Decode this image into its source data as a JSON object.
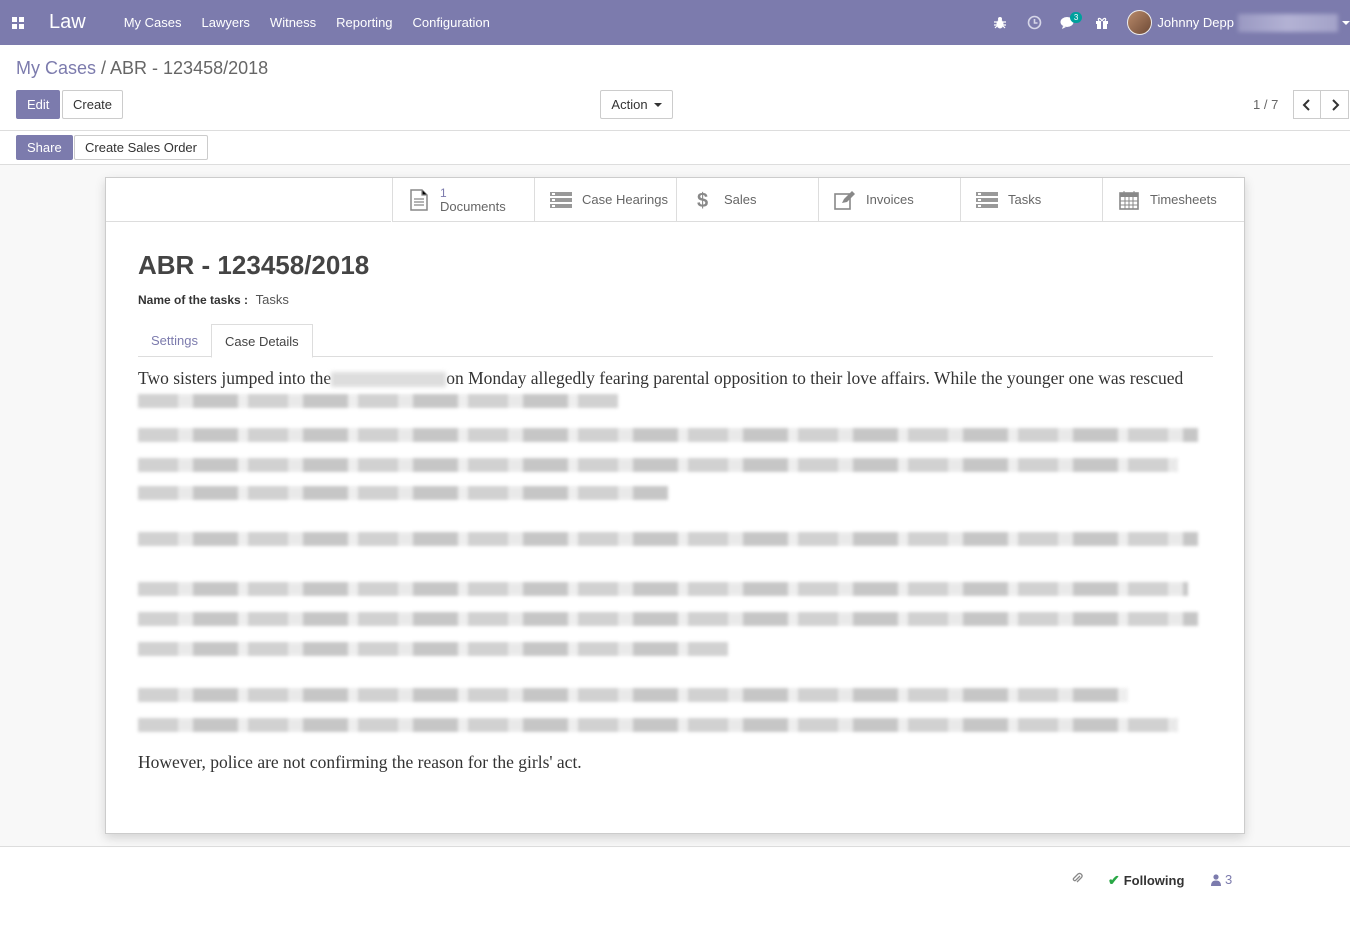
{
  "navbar": {
    "brand": "Law",
    "menu": [
      "My Cases",
      "Lawyers",
      "Witness",
      "Reporting",
      "Configuration"
    ],
    "chat_count": "3",
    "user_name": "Johnny Depp"
  },
  "control": {
    "breadcrumb_parent": "My Cases",
    "breadcrumb_sep": " / ",
    "breadcrumb_current": "ABR - 123458/2018",
    "edit_label": "Edit",
    "create_label": "Create",
    "action_label": "Action",
    "pager": "1 / 7"
  },
  "statusbar": {
    "share_label": "Share",
    "sales_order_label": "Create Sales Order"
  },
  "buttons": {
    "documents_count": "1",
    "documents_label": "Documents",
    "hearings_label": "Case Hearings",
    "sales_label": "Sales",
    "invoices_label": "Invoices",
    "tasks_label": "Tasks",
    "timesheets_label": "Timesheets"
  },
  "form": {
    "title": "ABR - 123458/2018",
    "field_label": "Name of the tasks :",
    "field_value": "Tasks",
    "tabs": [
      "Settings",
      "Case Details"
    ],
    "active_tab": "Case Details"
  },
  "details": {
    "first_start": "Two sisters jumped into the",
    "first_end": "on Monday allegedly fearing parental opposition to their love affairs. While the younger one was rescued",
    "last": "However, police are not confirming the reason for the girls' act."
  },
  "chatter": {
    "following_label": "Following",
    "followers_count": "3"
  },
  "colors": {
    "brand": "#7c7bad",
    "following_check": "#28a745",
    "badge": "#00a09d"
  }
}
